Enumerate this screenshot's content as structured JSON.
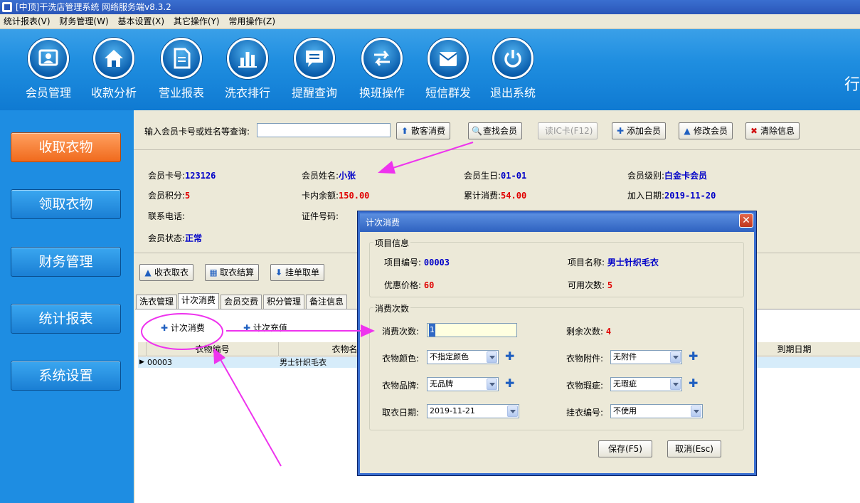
{
  "window": {
    "title": "[中顶]干洗店管理系统 网络服务端v8.3.2"
  },
  "menu": [
    "统计报表(V)",
    "财务管理(W)",
    "基本设置(X)",
    "其它操作(Y)",
    "常用操作(Z)"
  ],
  "toolbar": {
    "items": [
      {
        "label": "会员管理",
        "icon": "member-icon"
      },
      {
        "label": "收款分析",
        "icon": "home-icon"
      },
      {
        "label": "营业报表",
        "icon": "document-icon"
      },
      {
        "label": "洗衣排行",
        "icon": "bar-chart-icon"
      },
      {
        "label": "提醒查询",
        "icon": "message-icon"
      },
      {
        "label": "换班操作",
        "icon": "swap-icon"
      },
      {
        "label": "短信群发",
        "icon": "inbox-icon"
      },
      {
        "label": "退出系统",
        "icon": "power-icon"
      }
    ],
    "right_text": "行"
  },
  "sidebar": [
    "收取衣物",
    "领取衣物",
    "财务管理",
    "统计报表",
    "系统设置"
  ],
  "search": {
    "label": "输入会员卡号或姓名等查询:",
    "value": "",
    "buttons": {
      "walkin": "散客消费",
      "find": "查找会员",
      "read_ic": "读IC卡(F12)",
      "add": "添加会员",
      "edit": "修改会员",
      "clear": "清除信息"
    }
  },
  "member": {
    "card_label": "会员卡号:",
    "card": "123126",
    "name_label": "会员姓名:",
    "name": "小张",
    "birthday_label": "会员生日:",
    "birthday": "01-01",
    "level_label": "会员级别:",
    "level": "白金卡会员",
    "points_label": "会员积分:",
    "points": "5",
    "balance_label": "卡内余额:",
    "balance": "150.00",
    "total_label": "累计消费:",
    "total": "54.00",
    "joined_label": "加入日期:",
    "joined": "2019-11-20",
    "phone_label": "联系电话:",
    "id_label": "证件号码:",
    "status_label": "会员状态:",
    "status": "正常"
  },
  "actions": {
    "receive": "收衣取衣",
    "settle": "取衣结算",
    "hold": "挂单取单"
  },
  "tabs": [
    "洗衣管理",
    "计次消费",
    "会员交费",
    "积分管理",
    "备注信息"
  ],
  "subtoolbar": {
    "count_consume": "计次消费",
    "count_recharge": "计次充值"
  },
  "grid": {
    "columns": [
      "衣物编号",
      "衣物名",
      "到期日期"
    ],
    "rows": [
      {
        "code": "00003",
        "name": "男士针织毛衣"
      }
    ]
  },
  "dialog": {
    "title": "计次消费",
    "item_group": "项目信息",
    "item_code_label": "项目编号:",
    "item_code": "00003",
    "item_name_label": "项目名称:",
    "item_name": "男士针织毛衣",
    "price_label": "优惠价格:",
    "price": "60",
    "avail_label": "可用次数:",
    "avail": "5",
    "consume_group": "消费次数",
    "count_label": "消费次数:",
    "count": "1",
    "remain_label": "剩余次数:",
    "remain": "4",
    "color_label": "衣物颜色:",
    "color": "不指定颜色",
    "accessory_label": "衣物附件:",
    "accessory": "无附件",
    "brand_label": "衣物品牌:",
    "brand": "无品牌",
    "defect_label": "衣物瑕疵:",
    "defect": "无瑕疵",
    "pickup_label": "取衣日期:",
    "pickup": "2019-11-21",
    "hang_label": "挂衣编号:",
    "hang": "不使用",
    "save": "保存(F5)",
    "cancel": "取消(Esc)"
  },
  "colors": {
    "accent_blue": "#1e8de2",
    "active_orange": "#f06a1c",
    "annotation": "#ee33ee"
  }
}
